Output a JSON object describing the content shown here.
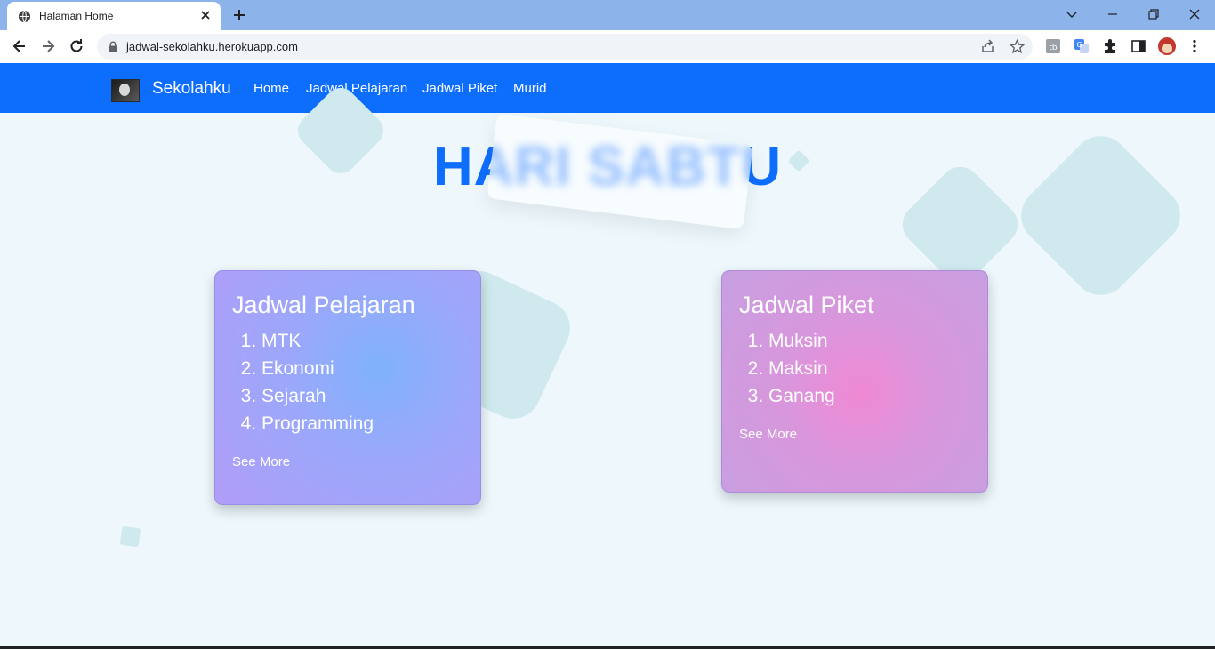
{
  "browser": {
    "tab_title": "Halaman Home",
    "url": "jadwal-sekolahku.herokuapp.com"
  },
  "navbar": {
    "brand": "Sekolahku",
    "links": [
      "Home",
      "Jadwal Pelajaran",
      "Jadwal Piket",
      "Murid"
    ]
  },
  "main": {
    "heading": "HARI SABTU",
    "cards": [
      {
        "title": "Jadwal Pelajaran",
        "items": [
          "MTK",
          "Ekonomi",
          "Sejarah",
          "Programming"
        ],
        "see_more": "See More"
      },
      {
        "title": "Jadwal Piket",
        "items": [
          "Muksin",
          "Maksin",
          "Ganang"
        ],
        "see_more": "See More"
      }
    ]
  },
  "colors": {
    "navbar": "#0d6efd",
    "heading": "#0d6efd",
    "background": "#eef8fc"
  }
}
